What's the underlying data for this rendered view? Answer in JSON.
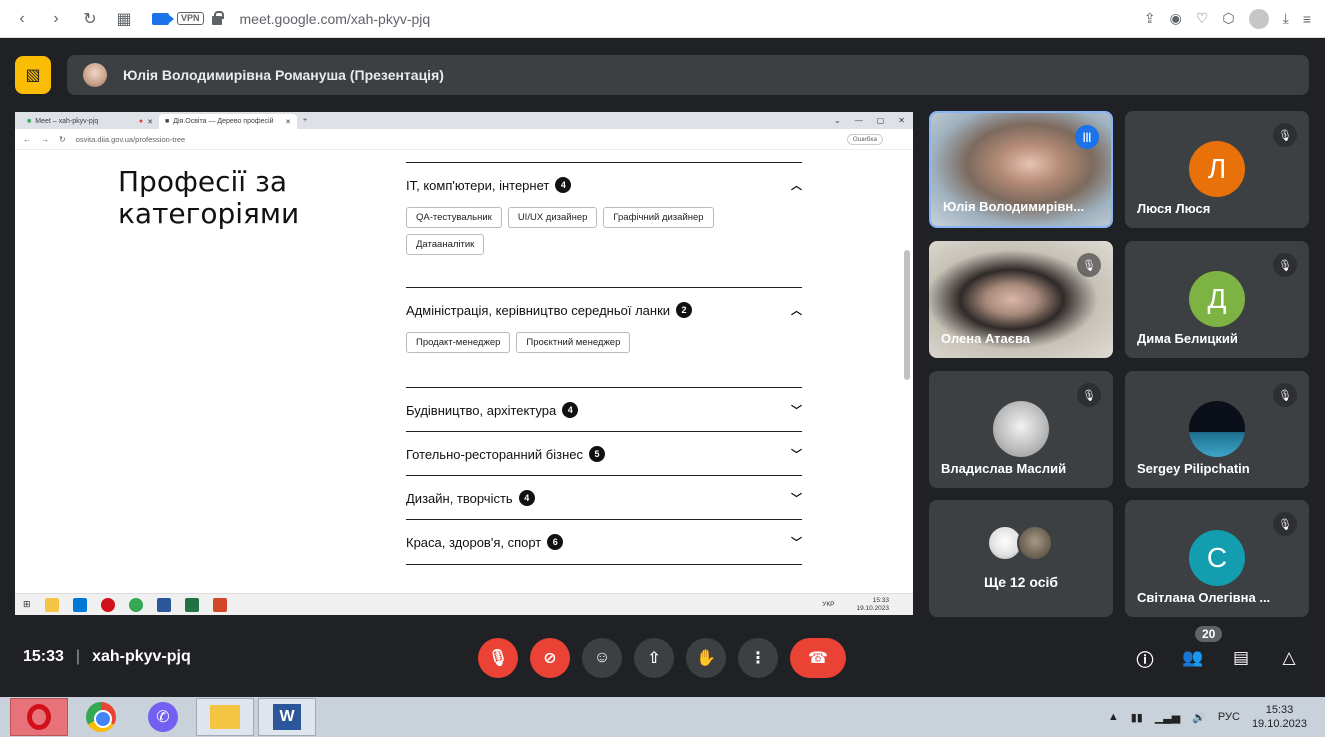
{
  "browser": {
    "url": "meet.google.com/xah-pkyv-pjq",
    "vpn_label": "VPN"
  },
  "presenter": {
    "name": "Юлія Володимирівна Романуша (Презентація)"
  },
  "shared": {
    "tabs": [
      {
        "label": "Meet – xah-pkyv-pjq"
      },
      {
        "label": "Дія.Освіта — Дерево професій"
      }
    ],
    "url": "osvita.diia.gov.ua/profession-tree",
    "error_badge": "Ошибка",
    "page_title": "Професії за категоріями",
    "categories": [
      {
        "title": "IT, комп'ютери, інтернет",
        "count": "4",
        "expanded": true,
        "tags": [
          "QA-тестувальник",
          "UI/UX дизайнер",
          "Графічний дизайнер",
          "Датааналітик"
        ]
      },
      {
        "title": "Адміністрація, керівництво середньої ланки",
        "count": "2",
        "expanded": true,
        "tags": [
          "Продакт-менеджер",
          "Проєктний менеджер"
        ]
      },
      {
        "title": "Будівництво, архітектура",
        "count": "4",
        "expanded": false
      },
      {
        "title": "Готельно-ресторанний бізнес",
        "count": "5",
        "expanded": false
      },
      {
        "title": "Дизайн, творчість",
        "count": "4",
        "expanded": false
      },
      {
        "title": "Краса, здоров'я, спорт",
        "count": "6",
        "expanded": false
      }
    ],
    "taskbar": {
      "lang": "УКР",
      "time": "15:33",
      "date": "19.10.2023"
    }
  },
  "participants": [
    {
      "name": "Юлія Володимирівна Романуша",
      "display": "Юлія Володимирівн...",
      "speaking": true
    },
    {
      "name": "Люся Люся",
      "letter": "Л",
      "color": "#e8710a"
    },
    {
      "name": "Олена Атаєва",
      "muted": true
    },
    {
      "name": "Дима Белицкий",
      "letter": "Д",
      "color": "#7cb342"
    },
    {
      "name": "Владислав Маслий",
      "muted": true
    },
    {
      "name": "Sergey Pilipchatin",
      "muted": true
    },
    {
      "name": "Ще 12 осіб"
    },
    {
      "name": "Світлана Олегівна ...",
      "letter": "С",
      "color": "#129eaf"
    }
  ],
  "meeting": {
    "time": "15:33",
    "separator": "|",
    "code": "xah-pkyv-pjq",
    "participant_count": "20"
  },
  "icons": {
    "mic_off": "mic-off-icon",
    "cam_off": "camera-off-icon",
    "emoji": "emoji-icon",
    "present": "present-screen-icon",
    "hand": "raise-hand-icon",
    "more": "more-options-icon",
    "hangup": "hang-up-icon",
    "info": "info-icon",
    "people": "people-icon",
    "chat": "chat-icon",
    "activities": "activities-icon"
  },
  "os_taskbar": {
    "lang": "РУС",
    "time": "15:33",
    "date": "19.10.2023"
  }
}
